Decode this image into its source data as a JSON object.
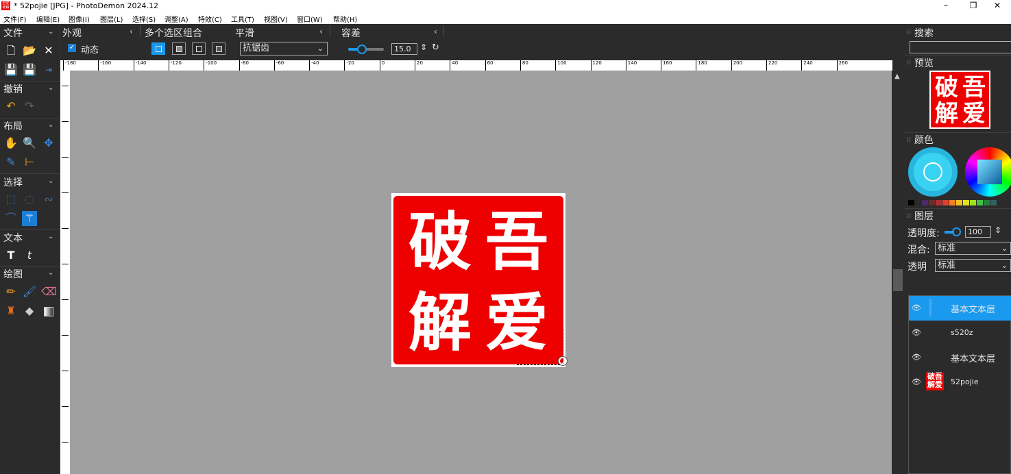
{
  "window": {
    "title": "* 52pojie [JPG]  -  PhotoDemon 2024.12",
    "minimize": "–",
    "restore": "❐",
    "close": "✕"
  },
  "menu": [
    "文件(F)",
    "编辑(E)",
    "图像(I)",
    "图层(L)",
    "选择(S)",
    "调整(A)",
    "特效(C)",
    "工具(T)",
    "视图(V)",
    "窗口(W)",
    "帮助(H)"
  ],
  "toolbox": {
    "sections": [
      "文件",
      "撤销",
      "布局",
      "选择",
      "文本",
      "绘图"
    ]
  },
  "options": {
    "appearance_label": "外观",
    "dynamic_label": "动态",
    "multi_selection_label": "多个选区组合",
    "smooth_label": "平滑",
    "smooth_value": "抗锯齿",
    "tolerance_label": "容差",
    "tolerance_value": "15.0",
    "tolerance_fraction": 0.15
  },
  "ruler": {
    "h_ticks": [
      "-180",
      "-160",
      "-140",
      "-120",
      "-100",
      "-80",
      "-60",
      "-40",
      "-20",
      "0",
      "20",
      "40",
      "60",
      "80",
      "100",
      "120",
      "140",
      "160",
      "180",
      "200",
      "220",
      "240",
      "260"
    ]
  },
  "image": {
    "seal_chars": [
      "破",
      "吾",
      "解",
      "爱"
    ]
  },
  "panel": {
    "search_label": "搜索",
    "preview_label": "预览",
    "color_label": "颜色",
    "layers_label": "图层",
    "opacity_label": "透明度:",
    "opacity_value": "100",
    "blend_label": "混合:",
    "blend_value": "标准",
    "alpha_label": "透明",
    "alpha_value": "标准"
  },
  "layers": [
    {
      "name": "基本文本层",
      "active": true
    },
    {
      "name": "s520z",
      "active": false
    },
    {
      "name": "基本文本层",
      "active": false
    },
    {
      "name": "52pojie",
      "active": false
    }
  ],
  "colors": {
    "accent": "#1a9aef",
    "seal_red": "#ee0000",
    "canvas_gray": "#a0a0a0"
  },
  "palette": [
    "#000000",
    "#2a2a2a",
    "#4b2b6b",
    "#6a2b2b",
    "#b03030",
    "#e04030",
    "#f08020",
    "#f0c020",
    "#e0e020",
    "#a0e020",
    "#40c040",
    "#208040",
    "#306060"
  ]
}
